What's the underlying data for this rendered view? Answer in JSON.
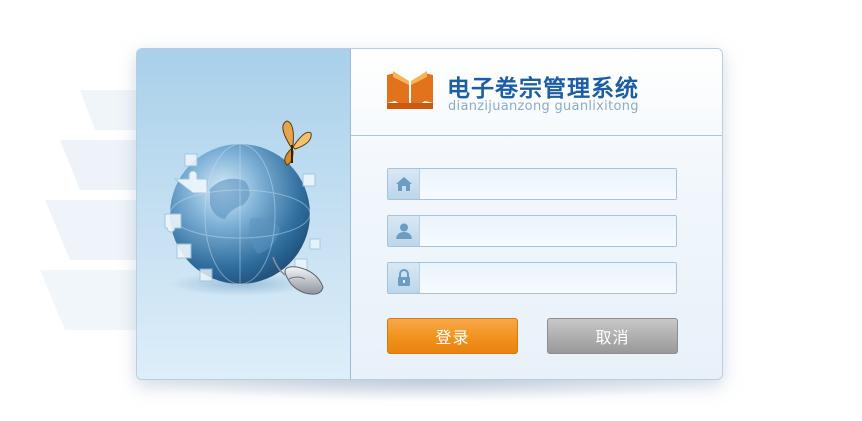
{
  "app": {
    "title": "电子卷宗管理系统",
    "subtitle": "dianzijuanzong guanlixitong"
  },
  "form": {
    "username_placeholder": "",
    "username_value": "",
    "name_placeholder": "",
    "name_value": "",
    "password_placeholder": "",
    "password_value": ""
  },
  "buttons": {
    "login_label": "登录",
    "cancel_label": "取消"
  },
  "icons": {
    "logo": "book-logo-icon",
    "field1": "home-icon",
    "field2": "user-icon",
    "field3": "lock-icon",
    "illustration": "puzzle-globe-icon"
  },
  "colors": {
    "brand": "#1c5ea3",
    "login": "#f2941f",
    "cancel": "#a6a6a6",
    "logo": "#e06a1a"
  }
}
